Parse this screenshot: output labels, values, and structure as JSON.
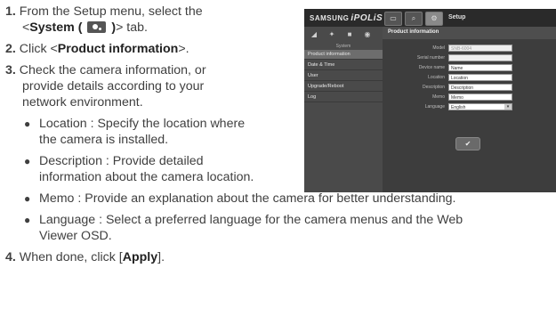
{
  "steps": [
    {
      "num": "1.",
      "pre": "From the Setup menu, select the",
      "line2_pre": "<",
      "tab_bold": "System ( ",
      "tab_close": " )",
      "line2_post": "> tab."
    },
    {
      "num": "2.",
      "pre": "Click <",
      "bold": "Product information",
      "post": ">."
    },
    {
      "num": "3.",
      "lines": [
        "Check the camera information, or",
        "provide details according to your",
        "network environment."
      ]
    },
    {
      "num": "4.",
      "pre": "When done, click [",
      "bold": "Apply",
      "post": "]."
    }
  ],
  "bullets": [
    {
      "lines": [
        "Location : Specify the location where",
        "the camera is installed."
      ]
    },
    {
      "lines": [
        "Description : Provide detailed",
        "information about the camera location."
      ]
    },
    {
      "lines": [
        "Memo : Provide an explanation about the camera for better understanding."
      ]
    },
    {
      "lines": [
        "Language : Select a preferred language for the camera menus and the Web",
        "Viewer OSD."
      ]
    }
  ],
  "screenshot": {
    "brand": "SAMSUNG",
    "logo": "iPOLiS",
    "menu_title": "Setup",
    "side_header": "System",
    "side_items": [
      "Product information",
      "Date & Time",
      "User",
      "Upgrade/Reboot",
      "Log"
    ],
    "panel_title": "Product information",
    "fields": [
      {
        "label": "Model",
        "value": "SNB-6004"
      },
      {
        "label": "Serial number",
        "value": ""
      },
      {
        "label": "Device name",
        "value": "Name"
      },
      {
        "label": "Location",
        "value": "Location"
      },
      {
        "label": "Description",
        "value": "Description"
      },
      {
        "label": "Memo",
        "value": "Memo"
      },
      {
        "label": "Language",
        "value": "English"
      }
    ]
  }
}
